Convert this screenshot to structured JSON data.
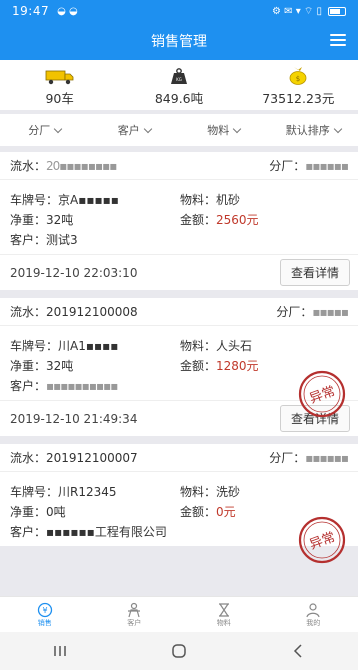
{
  "status": {
    "time": "19:47",
    "left_icons": "◒ ◒",
    "right_icons": "⚙ ✉ ▾ ⌔ ▯"
  },
  "header": {
    "title": "销售管理"
  },
  "summary": [
    {
      "icon": "truck-icon",
      "value": "90车"
    },
    {
      "icon": "weight-icon",
      "value": "849.6吨"
    },
    {
      "icon": "money-bag-icon",
      "value": "73512.23元"
    }
  ],
  "filters": [
    "分厂",
    "客户",
    "物料",
    "默认排序"
  ],
  "labels": {
    "serial": "流水：",
    "factory": "分厂：",
    "plate": "车牌号：",
    "material": "物料：",
    "net": "净重：",
    "amount": "金额：",
    "customer": "客户：",
    "detail_btn": "查看详情"
  },
  "orders": [
    {
      "serial": "20▪▪▪▪▪▪▪▪",
      "factory": "▪▪▪▪▪▪",
      "plate": "京A▪▪▪▪▪",
      "material": "机砂",
      "net": "32吨",
      "amount": "2560元",
      "customer": "测试3",
      "time": "2019-12-10 22:03:10",
      "stamp": ""
    },
    {
      "serial": "201912100008",
      "factory": "▪▪▪▪▪",
      "plate": "川A1▪▪▪▪",
      "material": "人头石",
      "net": "32吨",
      "amount": "1280元",
      "customer": "▪▪▪▪▪▪▪▪▪▪",
      "time": "2019-12-10 21:49:34",
      "stamp": "异常"
    },
    {
      "serial": "201912100007",
      "factory": "▪▪▪▪▪▪",
      "plate": "川R12345",
      "material": "洗砂",
      "net": "0吨",
      "amount": "0元",
      "customer": "▪▪▪▪▪▪工程有限公司",
      "time": "",
      "stamp": "异常"
    }
  ],
  "tabs": [
    {
      "icon": "sales-icon",
      "label": "销售",
      "active": true
    },
    {
      "icon": "customer-icon",
      "label": "客户",
      "active": false
    },
    {
      "icon": "material-icon",
      "label": "物料",
      "active": false
    },
    {
      "icon": "profile-icon",
      "label": "我的",
      "active": false
    }
  ],
  "colors": {
    "primary": "#1e90f0",
    "amount_red": "#c0392b",
    "stamp_red": "#b5302f"
  }
}
